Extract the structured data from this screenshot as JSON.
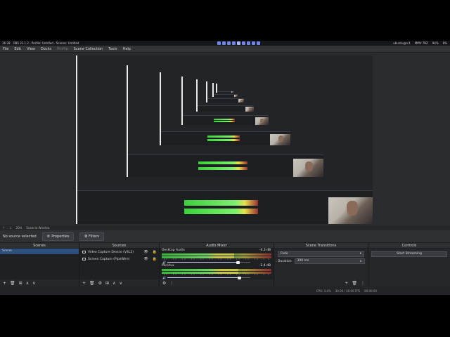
{
  "system_bar": {
    "time": "16:28",
    "app_info": "OBS 31.1.2 - Profile: Untitled - Scenes: Untitled",
    "workspaces": [
      "1",
      "2",
      "3",
      "4",
      "5",
      "6",
      "7",
      "8",
      "9"
    ],
    "current_workspace": "5",
    "user": "ubuntu@rc1",
    "cpu": "MMV 7BZ",
    "battery": "94%",
    "volume": "8%"
  },
  "menu": {
    "items": [
      "File",
      "Edit",
      "View",
      "Docks",
      "Profile",
      "Scene Collection",
      "Tools",
      "Help"
    ],
    "disabled_item": "Profile"
  },
  "status_row": {
    "items": [
      "↑",
      "↓",
      "20fs",
      "Scale to Window"
    ]
  },
  "toolbar": {
    "no_source": "No source selected",
    "properties_label": "Properties",
    "filters_label": "Filters",
    "properties_icon": "gear-icon",
    "filters_icon": "filter-icon"
  },
  "scenes_dock": {
    "title": "Scenes",
    "items": [
      {
        "label": "Scene",
        "selected": true
      }
    ],
    "footer": [
      "+",
      "🗑",
      "⊞",
      "∧",
      "∨"
    ]
  },
  "sources_dock": {
    "title": "Sources",
    "items": [
      {
        "label": "Video Capture Device (V4L2)",
        "icon": "camera-icon"
      },
      {
        "label": "Screen Capture (PipeWire)",
        "icon": "monitor-icon"
      }
    ],
    "footer": [
      "+",
      "🗑",
      "⚙",
      "⊞",
      "∧",
      "∨"
    ]
  },
  "mixer_dock": {
    "title": "Audio Mixer",
    "channels": [
      {
        "name": "Desktop Audio",
        "db": "-4.3 dB",
        "level": 0.66,
        "volume": 0.84
      },
      {
        "name": "Mic/Aux",
        "db": "-2.4 dB",
        "level": 0.7,
        "volume": 0.86
      }
    ],
    "ticks": "-60 -55 -50 -45 -40 -35 -30 -25 -20 -15 -10 -5 0",
    "footer": [
      "⚙",
      "⋮"
    ]
  },
  "transitions_dock": {
    "title": "Scene Transitions",
    "transition": "Fade",
    "duration_label": "Duration",
    "duration_value": "300 ms",
    "footer": [
      "+",
      "🗑",
      "⋮"
    ]
  },
  "controls_dock": {
    "title": "Controls",
    "start_streaming": "Start Streaming"
  },
  "bottom_bar": {
    "cpu": "CPU: 3.4%",
    "fps": "30.00 / 30.00 FPS",
    "time": "00:00:00"
  },
  "colors": {
    "accent": "#2d4f7c",
    "workspace": "#6f86e6",
    "meter_green": "#3bd13b",
    "meter_yellow": "#e6e14a",
    "meter_red": "#9b3030"
  }
}
